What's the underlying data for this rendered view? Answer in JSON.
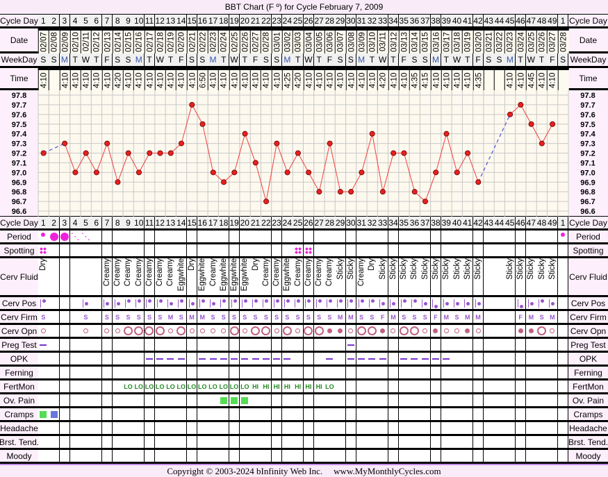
{
  "title": "BBT Chart (F º) for Cycle February 7, 2009",
  "row_labels": {
    "cycle_day": "Cycle Day",
    "date": "Date",
    "weekday": "WeekDay",
    "time": "Time",
    "period": "Period",
    "spotting": "Spotting",
    "cerv_fluid": "Cerv Fluid",
    "cerv_pos": "Cerv Pos",
    "cerv_firm": "Cerv Firm",
    "cerv_opn": "Cerv Opn",
    "preg_test": "Preg Test",
    "opk": "OPK",
    "ferning": "Ferning",
    "fertmon": "FertMon",
    "ov_pain": "Ov. Pain",
    "cramps": "Cramps",
    "headache": "Headache",
    "brst_tend": "Brst. Tend.",
    "moody": "Moody"
  },
  "footer": {
    "copyright": "Copyright © 2003-2024 bInfinity Web Inc.",
    "site": "www.MyMonthlyCycles.com"
  },
  "colors": {
    "temp_line": "#f04040",
    "temp_point": "#e82020",
    "gap_line": "#5050e0",
    "period": "#ee22dd",
    "fertmon": "#228822",
    "ov_pain": "#55dd55",
    "cramps_green": "#55dd55",
    "cramps_blue": "#6677dd",
    "cerv": "#9955cc",
    "opn": "#c06080",
    "opk": "#7733cc",
    "chart_bg": "#fdf9ee"
  },
  "chart_data": {
    "type": "line",
    "title": "BBT Chart (F º) for Cycle February 7, 2009",
    "ylim": [
      96.6,
      97.8
    ],
    "yticks": [
      "97.8",
      "97.7",
      "97.6",
      "97.5",
      "97.4",
      "97.3",
      "97.2",
      "97.1",
      "97.0",
      "96.9",
      "96.8",
      "96.7",
      "96.6"
    ],
    "grid": true,
    "x": [
      1,
      2,
      3,
      4,
      5,
      6,
      7,
      8,
      9,
      10,
      11,
      12,
      13,
      14,
      15,
      16,
      17,
      18,
      19,
      20,
      21,
      22,
      23,
      24,
      25,
      26,
      27,
      28,
      29,
      30,
      31,
      32,
      33,
      34,
      35,
      36,
      37,
      38,
      39,
      40,
      41,
      42,
      43,
      44,
      45,
      46,
      47,
      48,
      49,
      1
    ],
    "temps": [
      97.2,
      null,
      97.3,
      97.0,
      97.2,
      97.0,
      97.3,
      96.9,
      97.2,
      97.0,
      97.2,
      97.2,
      97.2,
      97.3,
      97.7,
      97.5,
      97.0,
      96.9,
      97.0,
      97.4,
      97.1,
      96.7,
      97.3,
      97.0,
      97.2,
      97.0,
      96.8,
      97.3,
      96.8,
      96.8,
      97.0,
      97.4,
      96.8,
      97.2,
      97.2,
      96.8,
      96.7,
      97.0,
      97.4,
      97.0,
      97.2,
      96.9,
      null,
      null,
      97.6,
      97.7,
      97.5,
      97.3,
      97.5,
      null
    ]
  },
  "days": {
    "cycle_day": [
      "1",
      "2",
      "3",
      "4",
      "5",
      "6",
      "7",
      "8",
      "9",
      "10",
      "11",
      "12",
      "13",
      "14",
      "15",
      "16",
      "17",
      "18",
      "19",
      "20",
      "21",
      "22",
      "23",
      "24",
      "25",
      "26",
      "27",
      "28",
      "29",
      "30",
      "31",
      "32",
      "33",
      "34",
      "35",
      "36",
      "37",
      "38",
      "39",
      "40",
      "41",
      "42",
      "43",
      "44",
      "45",
      "46",
      "47",
      "48",
      "49",
      "1"
    ],
    "date": [
      "02/07",
      "02/08",
      "02/09",
      "02/10",
      "02/11",
      "02/12",
      "02/13",
      "02/14",
      "02/15",
      "02/16",
      "02/17",
      "02/18",
      "02/19",
      "02/20",
      "02/21",
      "02/22",
      "02/23",
      "02/24",
      "02/25",
      "02/26",
      "02/27",
      "02/28",
      "03/01",
      "03/02",
      "03/03",
      "03/04",
      "03/05",
      "03/06",
      "03/07",
      "03/08",
      "03/09",
      "03/10",
      "03/11",
      "03/12",
      "03/13",
      "03/14",
      "03/15",
      "03/16",
      "03/17",
      "03/18",
      "03/19",
      "03/20",
      "03/21",
      "03/22",
      "03/23",
      "03/24",
      "03/25",
      "03/26",
      "03/27",
      "03/28"
    ],
    "weekday": [
      "S",
      "S",
      "M",
      "T",
      "W",
      "T",
      "F",
      "S",
      "S",
      "M",
      "T",
      "W",
      "T",
      "F",
      "S",
      "S",
      "M",
      "T",
      "W",
      "T",
      "F",
      "S",
      "S",
      "M",
      "T",
      "W",
      "T",
      "F",
      "S",
      "S",
      "M",
      "T",
      "W",
      "T",
      "F",
      "S",
      "S",
      "M",
      "T",
      "W",
      "T",
      "F",
      "S",
      "S",
      "M",
      "T",
      "W",
      "T",
      "F",
      "S"
    ],
    "time": [
      "4:10",
      "",
      "4:10",
      "4:10",
      "4:10",
      "4:10",
      "4:10",
      "4:20",
      "4:10",
      "4:10",
      "4:10",
      "4:10",
      "4:10",
      "4:10",
      "4:10",
      "6:50",
      "4:10",
      "4:10",
      "4:10",
      "4:10",
      "4:10",
      "4:10",
      "4:10",
      "4:25",
      "4:20",
      "4:10",
      "4:10",
      "4:10",
      "4:10",
      "4:10",
      "4:10",
      "4:10",
      "4:20",
      "4:10",
      "4:10",
      "4:35",
      "4:15",
      "4:10",
      "4:10",
      "4:10",
      "4:10",
      "4:35",
      "",
      "",
      "4:10",
      "4:10",
      "4:45",
      "4:10",
      "4:10",
      ""
    ],
    "period": [
      "light",
      "heavy",
      "heavy",
      "spotty",
      "spotty",
      "",
      "",
      "",
      "",
      "",
      "",
      "",
      "",
      "",
      "",
      "",
      "",
      "",
      "",
      "",
      "",
      "",
      "",
      "",
      "",
      "",
      "",
      "",
      "",
      "",
      "",
      "",
      "",
      "",
      "",
      "",
      "",
      "",
      "",
      "",
      "",
      "",
      "",
      "",
      "",
      "",
      "",
      "",
      "",
      "light"
    ],
    "spotting": [
      1,
      0,
      0,
      0,
      0,
      0,
      0,
      0,
      0,
      0,
      0,
      0,
      0,
      0,
      0,
      0,
      0,
      0,
      0,
      0,
      0,
      0,
      0,
      0,
      1,
      1,
      0,
      0,
      0,
      0,
      0,
      0,
      0,
      0,
      0,
      0,
      0,
      0,
      0,
      0,
      0,
      0,
      0,
      0,
      0,
      0,
      0,
      0,
      0,
      0
    ],
    "cerv_fluid": [
      "Dry",
      "",
      "",
      "",
      "",
      "",
      "Creamy",
      "Creamy",
      "Creamy",
      "Creamy",
      "Creamy",
      "Creamy",
      "Creamy",
      "Eggwhite",
      "Dry",
      "Eggwhite",
      "Creamy",
      "Eggwhite",
      "Eggwhite",
      "Eggwhite",
      "Dry",
      "Creamy",
      "Creamy",
      "Eggwhite",
      "Creamy",
      "Creamy",
      "Creamy",
      "Creamy",
      "Sticky",
      "Sticky",
      "Creamy",
      "Dry",
      "Sticky",
      "Sticky",
      "Sticky",
      "Sticky",
      "Sticky",
      "Sticky",
      "Sticky",
      "Sticky",
      "Sticky",
      "Sticky",
      "",
      "",
      "Sticky",
      "Sticky",
      "Sticky",
      "Sticky",
      "Sticky",
      ""
    ],
    "cerv_pos": [
      "H",
      "",
      "",
      "",
      "M",
      "",
      "M",
      "M",
      "H",
      "H",
      "H",
      "H",
      "M",
      "H",
      "M",
      "H",
      "M",
      "H",
      "H",
      "H",
      "H",
      "H",
      "H",
      "H",
      "H",
      "H",
      "H",
      "H",
      "H",
      "H",
      "H",
      "H",
      "M",
      "M",
      "H",
      "H",
      "M",
      "L",
      "M",
      "M",
      "M",
      "M",
      "",
      "",
      "",
      "L",
      "M",
      "H",
      "M",
      ""
    ],
    "cerv_firm": [
      "S",
      "",
      "",
      "",
      "S",
      "",
      "S",
      "S",
      "S",
      "S",
      "S",
      "S",
      "M",
      "S",
      "M",
      "M",
      "S",
      "S",
      "S",
      "S",
      "S",
      "S",
      "S",
      "S",
      "S",
      "S",
      "S",
      "S",
      "M",
      "M",
      "S",
      "S",
      "F",
      "M",
      "S",
      "S",
      "S",
      "F",
      "M",
      "S",
      "M",
      "M",
      "",
      "",
      "",
      "F",
      "M",
      "S",
      "M",
      ""
    ],
    "cerv_opn": [
      "small",
      "",
      "",
      "",
      "small",
      "",
      "small",
      "small",
      "large",
      "large",
      "large",
      "large",
      "small",
      "large",
      "small",
      "small",
      "small",
      "small",
      "large",
      "small",
      "large",
      "large",
      "small",
      "large",
      "small",
      "large",
      "large",
      "closed",
      "closed",
      "small",
      "large",
      "large",
      "closed",
      "small",
      "large",
      "large",
      "small",
      "closed",
      "small",
      "small",
      "closed",
      "small",
      "",
      "",
      "",
      "closed",
      "closed",
      "large",
      "small",
      ""
    ],
    "preg_test": [
      1,
      0,
      0,
      0,
      0,
      0,
      0,
      0,
      0,
      0,
      0,
      0,
      0,
      0,
      0,
      0,
      0,
      0,
      0,
      0,
      0,
      0,
      0,
      0,
      0,
      0,
      0,
      0,
      0,
      1,
      0,
      0,
      0,
      0,
      0,
      0,
      0,
      0,
      0,
      0,
      0,
      0,
      0,
      0,
      0,
      0,
      0,
      0,
      0,
      0
    ],
    "opk": [
      0,
      0,
      0,
      0,
      0,
      0,
      0,
      0,
      0,
      0,
      1,
      1,
      1,
      1,
      0,
      1,
      1,
      1,
      1,
      1,
      1,
      1,
      1,
      1,
      0,
      0,
      0,
      1,
      0,
      1,
      1,
      1,
      1,
      0,
      1,
      1,
      1,
      1,
      1,
      0,
      0,
      0,
      0,
      0,
      0,
      0,
      0,
      0,
      0,
      0
    ],
    "fertmon": [
      "",
      "",
      "",
      "",
      "",
      "",
      "",
      "",
      "LO",
      "LO",
      "LO",
      "LO",
      "LO",
      "LO",
      "LO",
      "LO",
      "LO",
      "LO",
      "LO",
      "LO",
      "HI",
      "HI",
      "HI",
      "HI",
      "HI",
      "HI",
      "HI",
      "LO",
      "",
      "",
      "",
      "",
      "",
      "",
      "",
      "",
      "",
      "",
      "",
      "",
      "",
      "",
      "",
      "",
      "",
      "",
      "",
      "",
      "",
      ""
    ],
    "ov_pain": [
      0,
      0,
      0,
      0,
      0,
      0,
      0,
      0,
      0,
      0,
      0,
      0,
      0,
      0,
      0,
      0,
      0,
      1,
      1,
      1,
      0,
      0,
      0,
      0,
      0,
      0,
      0,
      0,
      0,
      0,
      0,
      0,
      0,
      0,
      0,
      0,
      0,
      0,
      0,
      0,
      0,
      0,
      0,
      0,
      0,
      0,
      0,
      0,
      0,
      0
    ],
    "cramps": [
      "green",
      "blue",
      "",
      "",
      "",
      "",
      "",
      "",
      "",
      "",
      "",
      "",
      "",
      "",
      "",
      "",
      "",
      "",
      "",
      "",
      "",
      "",
      "",
      "",
      "",
      "",
      "",
      "",
      "",
      "",
      "",
      "",
      "",
      "",
      "",
      "",
      "",
      "",
      "",
      "",
      "",
      "",
      "",
      "",
      "",
      "",
      "",
      "",
      "",
      ""
    ]
  }
}
